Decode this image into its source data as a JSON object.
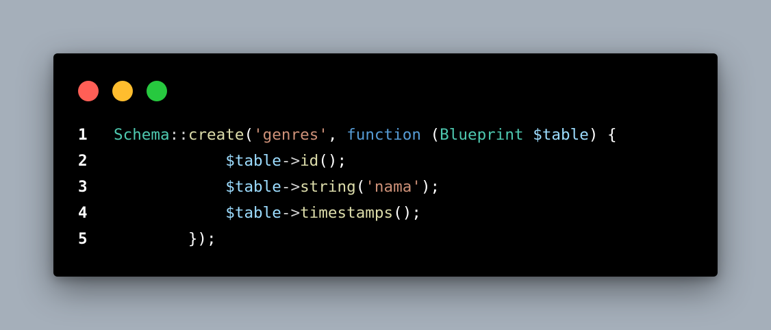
{
  "window": {
    "controls": {
      "close_color": "#ff5f56",
      "minimize_color": "#ffbd2e",
      "maximize_color": "#27c93f"
    }
  },
  "code": {
    "lines": [
      {
        "number": "1",
        "tokens": [
          {
            "text": "Schema",
            "kind": "class"
          },
          {
            "text": "::",
            "kind": "op"
          },
          {
            "text": "create",
            "kind": "func"
          },
          {
            "text": "(",
            "kind": "punc"
          },
          {
            "text": "'genres'",
            "kind": "str"
          },
          {
            "text": ", ",
            "kind": "punc"
          },
          {
            "text": "function",
            "kind": "kw"
          },
          {
            "text": " (",
            "kind": "punc"
          },
          {
            "text": "Blueprint",
            "kind": "class"
          },
          {
            "text": " ",
            "kind": "punc"
          },
          {
            "text": "$table",
            "kind": "var"
          },
          {
            "text": ") {",
            "kind": "punc"
          }
        ]
      },
      {
        "number": "2",
        "tokens": [
          {
            "text": "            ",
            "kind": "punc"
          },
          {
            "text": "$table",
            "kind": "var"
          },
          {
            "text": "->",
            "kind": "op"
          },
          {
            "text": "id",
            "kind": "func"
          },
          {
            "text": "();",
            "kind": "punc"
          }
        ]
      },
      {
        "number": "3",
        "tokens": [
          {
            "text": "            ",
            "kind": "punc"
          },
          {
            "text": "$table",
            "kind": "var"
          },
          {
            "text": "->",
            "kind": "op"
          },
          {
            "text": "string",
            "kind": "func"
          },
          {
            "text": "(",
            "kind": "punc"
          },
          {
            "text": "'nama'",
            "kind": "str"
          },
          {
            "text": ");",
            "kind": "punc"
          }
        ]
      },
      {
        "number": "4",
        "tokens": [
          {
            "text": "            ",
            "kind": "punc"
          },
          {
            "text": "$table",
            "kind": "var"
          },
          {
            "text": "->",
            "kind": "op"
          },
          {
            "text": "timestamps",
            "kind": "func"
          },
          {
            "text": "();",
            "kind": "punc"
          }
        ]
      },
      {
        "number": "5",
        "tokens": [
          {
            "text": "        ",
            "kind": "punc"
          },
          {
            "text": "});",
            "kind": "punc"
          }
        ]
      }
    ]
  }
}
